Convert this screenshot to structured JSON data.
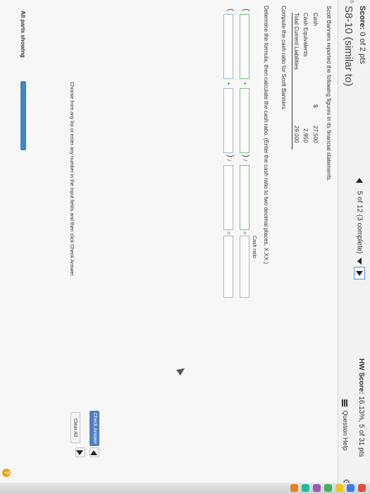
{
  "header": {
    "score_label": "Score:",
    "score_value": "0 of 2 pts",
    "title": "S8-10 (similar to)",
    "nav_text": "5 of 12 (3 complete)",
    "hw_label": "HW Score:",
    "hw_value": "16.13%, 5 of 31 pts",
    "question_help": "Question Help",
    "corner_digit": "35",
    "top_digit": "6"
  },
  "problem": {
    "intro": "Scott Banners reported the following figures in its financial statements.",
    "items": [
      {
        "label": "Cash",
        "currency": "$",
        "value": "27,500"
      },
      {
        "label": "Cash Equivalents",
        "currency": "",
        "value": "2,950"
      },
      {
        "label": "Total Current Liabilities",
        "currency": "",
        "value": "29,000"
      }
    ],
    "task": "Compute the cash ratio for Scott Banners.",
    "instruction": "Determine the formula, then calculate the cash ratio. (Enter the cash ratio to two decimal places, X.XX.)",
    "result_label": "Cash ratio",
    "row1": {
      "open": "(",
      "plus": "+",
      "close": ")",
      "div": "/",
      "eq": "="
    },
    "row2": {
      "open": "(",
      "plus": "+",
      "close": ")",
      "div": "/",
      "eq": "="
    }
  },
  "footer": {
    "instructions": "Choose from any list or enter any number in the input fields and then click Check Answer.",
    "parts_label": "All parts showing",
    "clear_all": "Clear All",
    "check_answer": "Check Answer",
    "help_symbol": "?"
  },
  "icons": [
    "left-triangle-icon",
    "down-triangle-icon",
    "right-triangle-icon",
    "list-icon",
    "gear-icon",
    "help-icon",
    "cursor-icon"
  ],
  "colors": {
    "accent": "#3e86c6",
    "button": "#4f7ec4",
    "help": "#e8a51e"
  }
}
